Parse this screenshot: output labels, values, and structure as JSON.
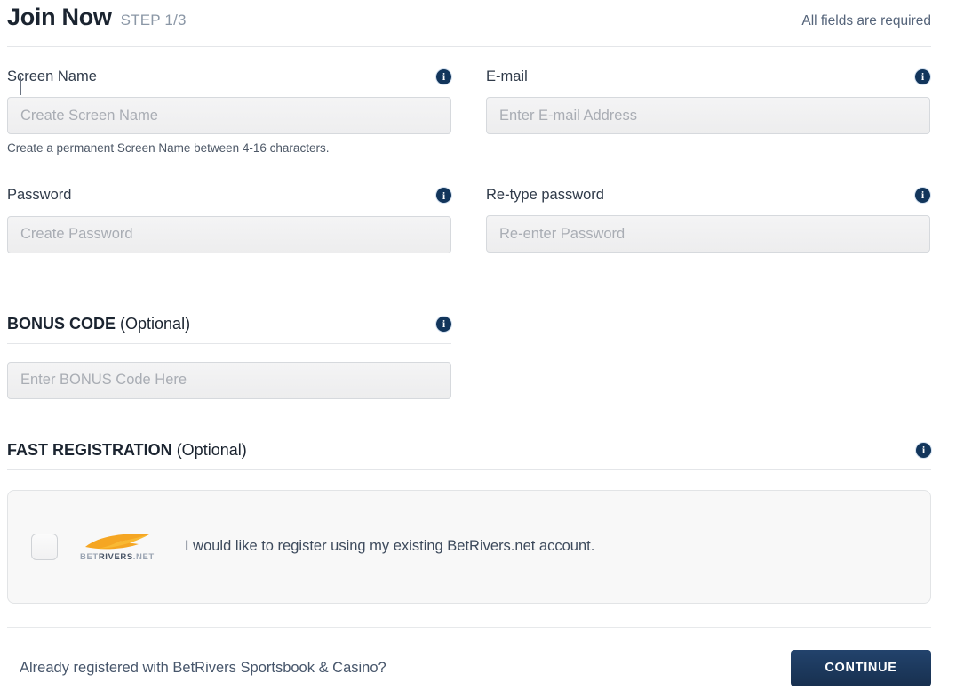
{
  "header": {
    "title": "Join Now",
    "step": "STEP 1/3",
    "required_note": "All fields are required"
  },
  "fields": {
    "screen_name": {
      "label": "Screen Name",
      "placeholder": "Create Screen Name",
      "value": "",
      "helper": "Create a permanent Screen Name between 4-16 characters.",
      "info_icon": "info-icon"
    },
    "email": {
      "label": "E-mail",
      "placeholder": "Enter E-mail Address",
      "value": "",
      "info_icon": "info-icon"
    },
    "password": {
      "label": "Password",
      "placeholder": "Create Password",
      "value": "",
      "info_icon": "info-icon"
    },
    "retype_password": {
      "label": "Re-type password",
      "placeholder": "Re-enter Password",
      "value": "",
      "info_icon": "info-icon"
    }
  },
  "bonus_code": {
    "title_strong": "BONUS CODE",
    "title_optional": "(Optional)",
    "placeholder": "Enter BONUS Code Here",
    "value": "",
    "info_icon": "info-icon"
  },
  "fast_registration": {
    "title_strong": "FAST REGISTRATION",
    "title_optional": "(Optional)",
    "info_icon": "info-icon",
    "checkbox_checked": false,
    "logo": {
      "name": "betrivers-net-logo",
      "wordmark_bet": "BET",
      "wordmark_rivers": "RIVERS",
      "wordmark_net": ".NET",
      "swoosh_color": "#f5a623"
    },
    "consent_text": "I would like to register using my existing BetRivers.net account."
  },
  "footer": {
    "already_registered": "Already registered with BetRivers Sportsbook & Casino?",
    "continue_label": "CONTINUE"
  },
  "colors": {
    "accent_navy": "#1d3a5f",
    "brand_orange": "#f5a623",
    "text_primary": "#3d4a5c",
    "muted": "#8b97a6",
    "input_bg": "#f1f1f2",
    "border": "#d6d9dd"
  }
}
